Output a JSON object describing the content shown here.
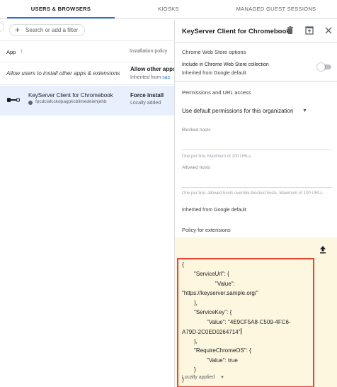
{
  "tabs": [
    {
      "label": "USERS & BROWSERS",
      "active": true
    },
    {
      "label": "KIOSKS",
      "active": false
    },
    {
      "label": "MANAGED GUEST SESSIONS",
      "active": false
    }
  ],
  "left": {
    "filter_placeholder": "Search or add a filter",
    "columns": {
      "app": "App",
      "policy": "Installation policy"
    },
    "allow_row": {
      "label": "Allow users to install other apps & extensions",
      "policy": "Allow other apps",
      "inherited_prefix": "Inherited from ",
      "inherited_link": "sas"
    },
    "app_row": {
      "name": "KeyServer Client for Chromebook",
      "id": "fpcdclafcckdpagpkcbilmedeiehjehb",
      "policy": "Force install",
      "status": "Locally added"
    }
  },
  "right": {
    "title": "KeyServer Client for Chromebook",
    "cws_section": {
      "title": "Chrome Web Store options",
      "include_label": "Include in Chrome Web Store collection",
      "inherited": "Inherited from Google default",
      "toggle_on": false
    },
    "permissions": {
      "title": "Permissions and URL access",
      "select_value": "Use default permissions for this organization",
      "blocked_label": "Blocked hosts",
      "blocked_hint": "One per line. Maximum of 100 URLs.",
      "allowed_label": "Allowed hosts",
      "allowed_hint": "One per line; allowed hosts override blocked hosts. Maximum of 100 URLs.",
      "inherited": "Inherited from Google default"
    },
    "policy": {
      "title": "Policy for extensions",
      "json_lines": [
        "{",
        "\"ServiceUrl\": {",
        "\"Value\":",
        "\"https://keyserver.sample.org/\"",
        "},",
        "\"ServiceKey\": {",
        "\"Value\": \"4E9CF5A8-C509-4FC6-",
        "A79D-2C0ED0264714\"",
        "},",
        "\"RequireChromeOS\": {",
        "\"Value\": true",
        "}",
        "}"
      ],
      "footer": "Locally applied"
    }
  },
  "colors": {
    "accent": "#1a73e8",
    "highlight_border": "#ea4335",
    "policy_bg": "#fef7e0",
    "selected_row": "#e8f0fe"
  },
  "icons": [
    "add-icon",
    "sort-arrow-up-icon",
    "key-icon",
    "chrome-dot-icon",
    "trash-icon",
    "open-in-new-icon",
    "close-icon",
    "dropdown-caret-icon",
    "upload-icon"
  ]
}
